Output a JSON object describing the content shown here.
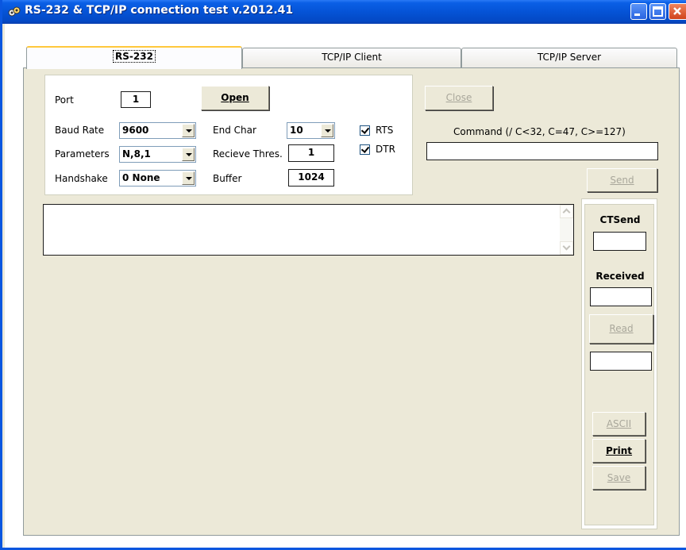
{
  "window": {
    "title": "RS-232 & TCP/IP connection test  v.2012.41",
    "accent_color": "#0553d6",
    "app_icon": "network-app-icon"
  },
  "tabs": [
    {
      "label": "RS-232",
      "active": true
    },
    {
      "label": "TCP/IP Client",
      "active": false
    },
    {
      "label": "TCP/IP Server",
      "active": false
    }
  ],
  "serial": {
    "port_label": "Port",
    "port_value": "1",
    "open_label": "Open",
    "baud_label": "Baud Rate",
    "baud_value": "9600",
    "params_label": "Parameters",
    "params_value": "N,8,1",
    "handshake_label": "Handshake",
    "handshake_value": "0 None",
    "endchar_label": "End Char",
    "endchar_value": "10",
    "thres_label": "Recieve Thres.",
    "thres_value": "1",
    "buffer_label": "Buffer",
    "buffer_value": "1024",
    "rts_label": "RTS",
    "rts_checked": true,
    "dtr_label": "DTR",
    "dtr_checked": true
  },
  "command": {
    "close_label": "Close",
    "label": "Command (/ C<32, C=47, C>=127)",
    "value": "",
    "send_label": "Send"
  },
  "output": {
    "text": ""
  },
  "side": {
    "ctsend_label": "CTSend",
    "ctsend_value": "",
    "received_label": "Received",
    "received_value": "",
    "read_label": "Read",
    "read_value": "",
    "ascii_label": "ASCII",
    "print_label": "Print",
    "save_label": "Save"
  }
}
